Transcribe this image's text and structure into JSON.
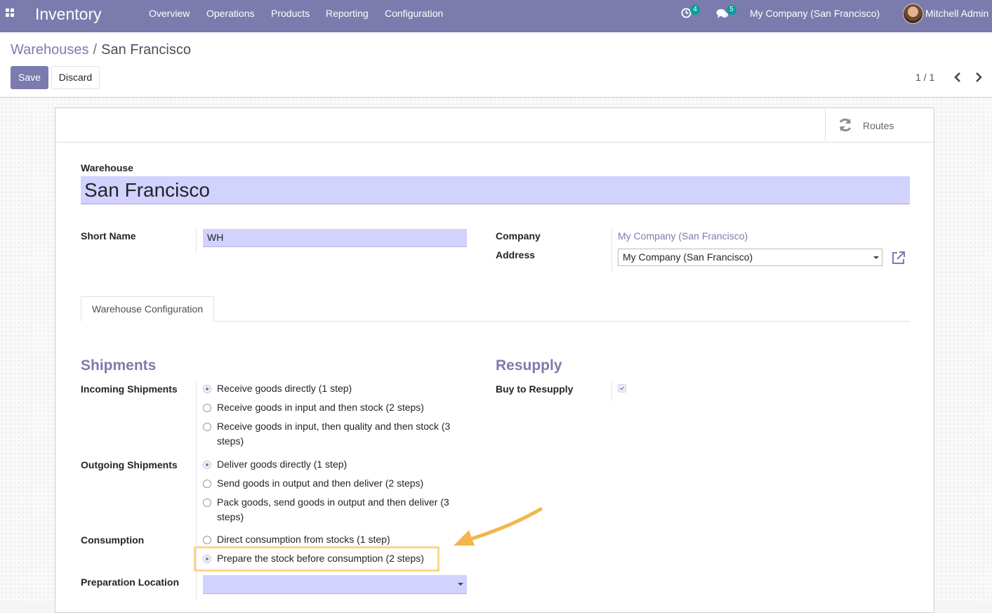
{
  "navbar": {
    "app_title": "Inventory",
    "menu": [
      "Overview",
      "Operations",
      "Products",
      "Reporting",
      "Configuration"
    ],
    "activity_count": "4",
    "message_count": "5",
    "company": "My Company (San Francisco)",
    "user": "Mitchell Admin"
  },
  "breadcrumb": {
    "parent": "Warehouses",
    "separator": "/",
    "current": "San Francisco"
  },
  "toolbar": {
    "save_label": "Save",
    "discard_label": "Discard",
    "pager": "1 / 1"
  },
  "button_box": {
    "routes_label": "Routes"
  },
  "form": {
    "warehouse_label": "Warehouse",
    "warehouse_name": "San Francisco",
    "short_name_label": "Short Name",
    "short_name_value": "WH",
    "company_label": "Company",
    "company_value": "My Company (San Francisco)",
    "address_label": "Address",
    "address_value": "My Company (San Francisco)"
  },
  "tabs": [
    "Warehouse Configuration"
  ],
  "shipments": {
    "title": "Shipments",
    "incoming_label": "Incoming Shipments",
    "incoming_options": [
      {
        "label": "Receive goods directly (1 step)",
        "checked": true
      },
      {
        "label": "Receive goods in input and then stock (2 steps)",
        "checked": false
      },
      {
        "label": "Receive goods in input, then quality and then stock (3",
        "label_cont": "steps)",
        "checked": false
      }
    ],
    "outgoing_label": "Outgoing Shipments",
    "outgoing_options": [
      {
        "label": "Deliver goods directly (1 step)",
        "checked": true
      },
      {
        "label": "Send goods in output and then deliver (2 steps)",
        "checked": false
      },
      {
        "label": "Pack goods, send goods in output and then deliver (3",
        "label_cont": "steps)",
        "checked": false
      }
    ],
    "consumption_label": "Consumption",
    "consumption_options": [
      {
        "label": "Direct consumption from stocks (1 step)",
        "checked": false
      },
      {
        "label": "Prepare the stock before consumption (2 steps)",
        "checked": true
      }
    ],
    "preparation_location_label": "Preparation Location",
    "preparation_location_value": ""
  },
  "resupply": {
    "title": "Resupply",
    "buy_label": "Buy to Resupply",
    "buy_checked": true
  },
  "colors": {
    "brand": "#7c7bad",
    "input_bg": "#d2d2ff",
    "badge": "#00a09d",
    "highlight": "#fbd58d",
    "arrow": "#f3b64c"
  }
}
